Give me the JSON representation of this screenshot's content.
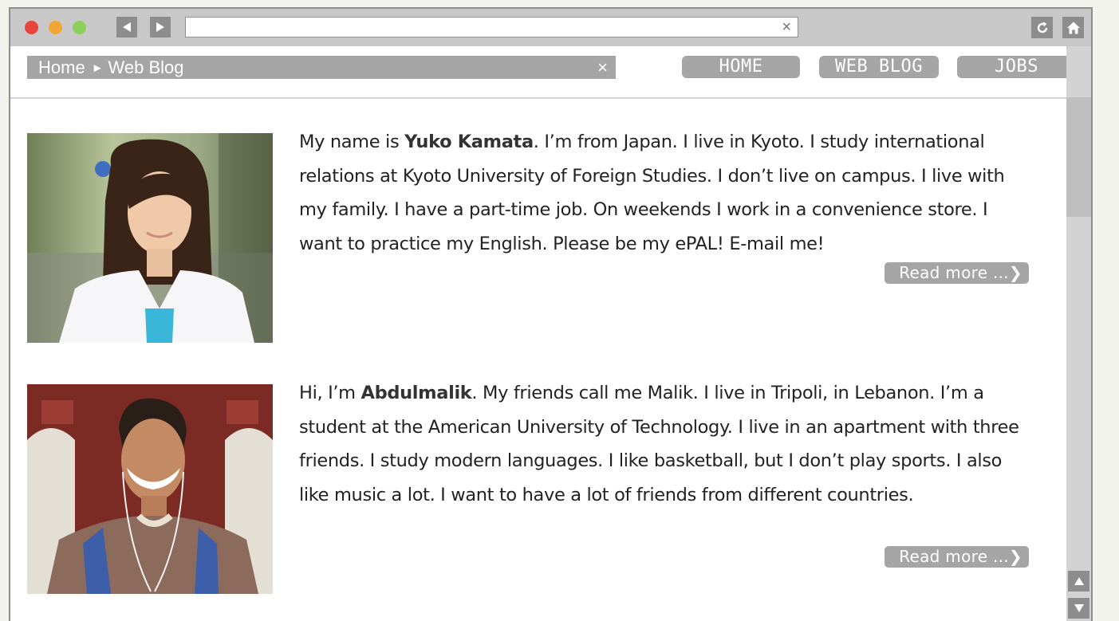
{
  "browser": {
    "address_value": "",
    "address_clear_icon": "×",
    "traffic_light_colors": [
      "#e8453c",
      "#f2a534",
      "#8ccf5a"
    ]
  },
  "navbar": {
    "breadcrumb_home": "Home",
    "breadcrumb_separator": "►",
    "breadcrumb_current": "Web Blog",
    "breadcrumb_clear_icon": "×",
    "tabs": [
      {
        "label": "HOME"
      },
      {
        "label": "WEB BLOG"
      },
      {
        "label": "JOBS"
      }
    ]
  },
  "posts": [
    {
      "intro": "My name is ",
      "name": "Yuko Kamata",
      "body": ". I’m from Japan. I live in Kyoto. I study international relations at Kyoto University of Foreign Studies. I don’t live on campus. I live with my family. I have a part-time job. On weekends I work in a convenience store. I want to practice my English. Please be my ePAL! E-mail me!",
      "read_more": "Read more ...❯"
    },
    {
      "intro": "Hi, I’m ",
      "name": "Abdulmalik",
      "body": ". My friends call me Malik. I live in Tripoli, in Lebanon. I’m a student at the American University of Technology. I live in an apartment with three friends. I study modern languages. I like basketball, but I don’t play sports. I also like music a lot. I want to have a lot of friends from different countries.",
      "read_more": "Read more ...❯"
    }
  ]
}
